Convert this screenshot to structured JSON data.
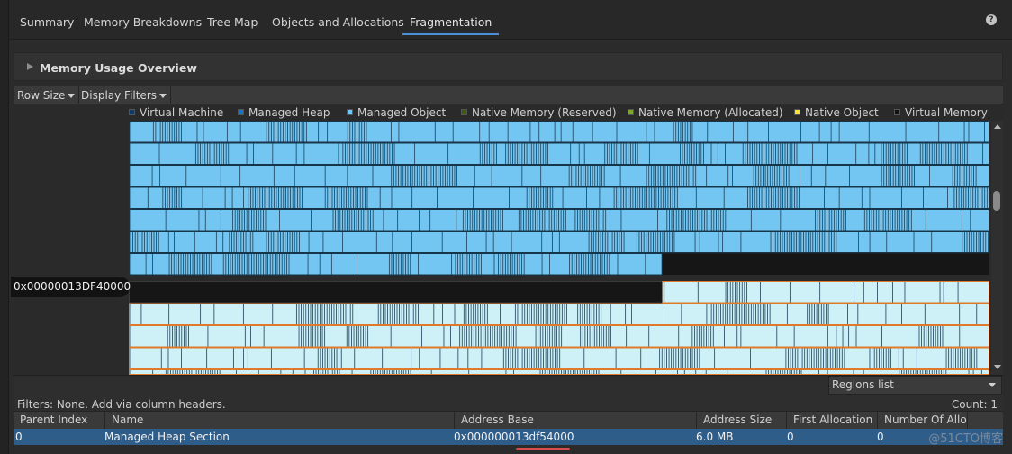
{
  "tabs": [
    {
      "label": "Summary"
    },
    {
      "label": "Memory Breakdowns"
    },
    {
      "label": "Tree Map"
    },
    {
      "label": "Objects and Allocations"
    },
    {
      "label": "Fragmentation",
      "active": true
    }
  ],
  "help_icon": {
    "glyph": "?",
    "icon": "help-icon"
  },
  "overview": {
    "title": "Memory Usage Overview"
  },
  "toolbar": {
    "row_size": "Row Size",
    "display_filters": "Display Filters"
  },
  "legend": [
    {
      "label": "Virtual Machine",
      "color": "#0f3c66"
    },
    {
      "label": "Managed Heap",
      "color": "#1e73c8"
    },
    {
      "label": "Managed Object",
      "color": "#78c6f0"
    },
    {
      "label": "Native Memory (Reserved)",
      "color": "#3d5a10"
    },
    {
      "label": "Native Memory (Allocated)",
      "color": "#7fa52a"
    },
    {
      "label": "Native Object",
      "color": "#f5e62a"
    },
    {
      "label": "Virtual Memory",
      "color": "#121212"
    }
  ],
  "address_label": "0x00000013DF40000",
  "colors": {
    "managed_object": "#74c6f2",
    "managed_object_light": "#cdf1f7",
    "stripe_dark": "#1c3f58",
    "empty": "#161616",
    "highlight": "#e07a2a"
  },
  "fragmentation": {
    "upper_rows": 6,
    "upper_last_row_fill": 0.62,
    "lower_first_row_fill": 0.62,
    "lower_rows": 4
  },
  "regions_select": {
    "value": "Regions list"
  },
  "filters": {
    "text": "Filters:  None. Add via column headers."
  },
  "count": {
    "text": "Count: 1"
  },
  "table": {
    "columns": [
      "Parent Index",
      "Name",
      "Address Base",
      "Address Size",
      "First Allocation I",
      "Number Of Alloc"
    ],
    "rows": [
      [
        "0",
        "Managed Heap Section",
        "0x000000013df54000",
        "6.0 MB",
        "0",
        "0"
      ]
    ]
  },
  "watermark": "@51CTO博客"
}
